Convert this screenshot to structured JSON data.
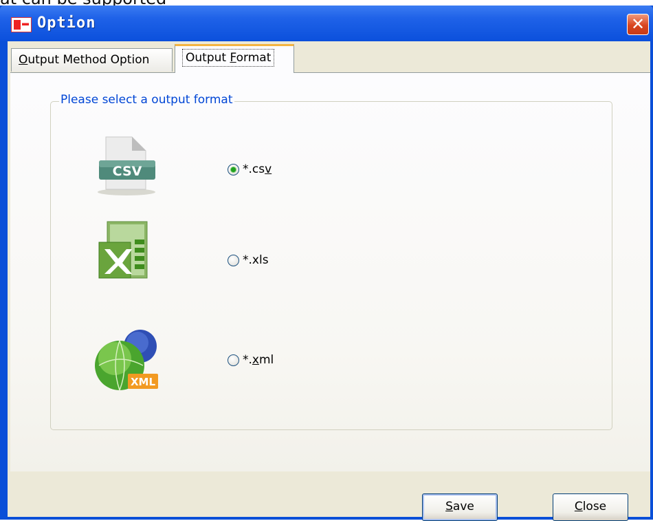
{
  "background_text": "at can be supported",
  "window": {
    "title": "Option",
    "close_glyph": "✕"
  },
  "tabs": [
    {
      "label_html": "<u>O</u>utput Method Option",
      "label": "Output Method Option",
      "active": false
    },
    {
      "label": "Output Format",
      "active": true
    }
  ],
  "group": {
    "legend": "Please select a output format"
  },
  "formats": [
    {
      "icon": "csv-file-icon",
      "label": "*.csv",
      "checked": true
    },
    {
      "icon": "excel-file-icon",
      "label": "*.xls",
      "checked": false
    },
    {
      "icon": "xml-globe-icon",
      "label": "*.xml",
      "checked": false
    }
  ],
  "buttons": {
    "save": "Save",
    "close": "Close"
  },
  "colors": {
    "titlebar": "#0b50dc",
    "legend_text": "#0046d5",
    "tab_highlight": "#f4b441",
    "dialog_face": "#ece9d8"
  }
}
